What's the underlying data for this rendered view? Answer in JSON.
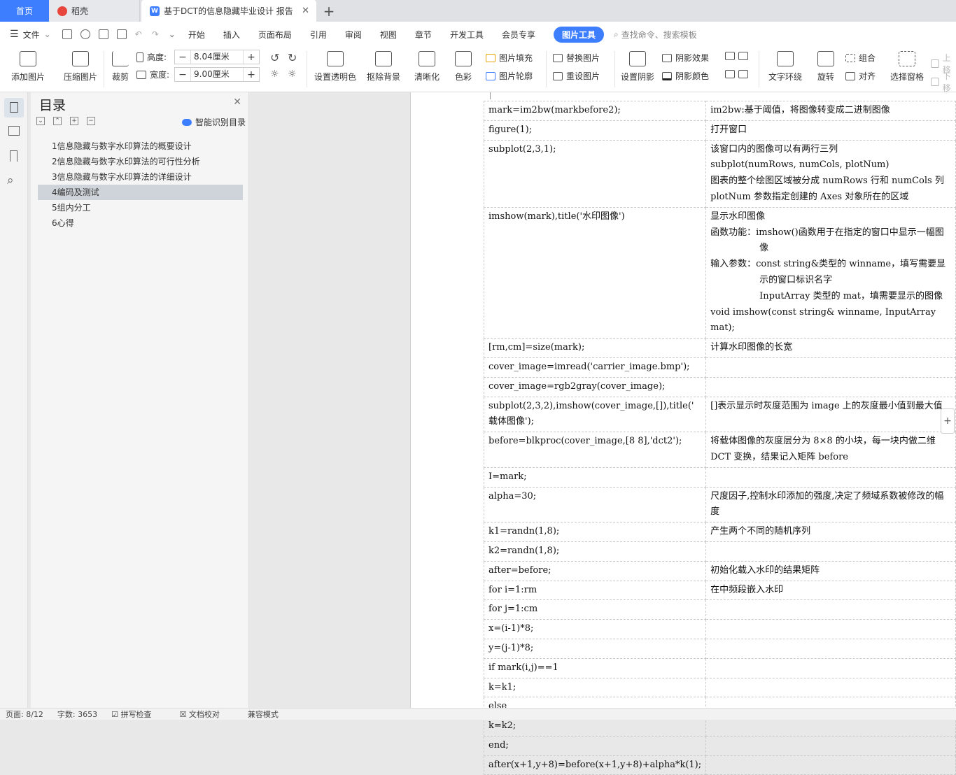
{
  "tabs": {
    "home": "首页",
    "daoke": "稻壳",
    "document": "基于DCT的信息隐藏毕业设计 报告"
  },
  "menubar": {
    "file": "文件",
    "items": [
      "开始",
      "插入",
      "页面布局",
      "引用",
      "审阅",
      "视图",
      "章节",
      "开发工具",
      "会员专享"
    ],
    "active": "图片工具",
    "search": "查找命令、搜索模板"
  },
  "ribbon": {
    "add_picture": "添加图片",
    "compress": "压缩图片",
    "crop": "裁剪",
    "height_label": "高度:",
    "height_value": "8.04厘米",
    "width_label": "宽度:",
    "width_value": "9.00厘米",
    "transparent": "设置透明色",
    "remove_bg": "抠除背景",
    "sharpen": "清晰化",
    "color": "色彩",
    "fill": "图片填充",
    "outline": "图片轮廓",
    "replace": "替换图片",
    "reset": "重设图片",
    "shadow": "设置阴影",
    "shadow_effect": "阴影效果",
    "shadow_color": "阴影颜色",
    "wrap": "文字环绕",
    "rotate": "旋转",
    "group": "组合",
    "align": "对齐",
    "select_pane": "选择窗格",
    "up": "上移",
    "down": "下移"
  },
  "toc": {
    "title": "目录",
    "smart": "智能识别目录",
    "items": [
      "1信息隐藏与数字水印算法的概要设计",
      "2信息隐藏与数字水印算法的可行性分析",
      "3信息隐藏与数字水印算法的详细设计",
      "4编码及测试",
      "5组内分工",
      "6心得"
    ]
  },
  "table": [
    [
      "mark=im2bw(markbefore2);",
      "im2bw:基于阈值，将图像转变成二进制图像"
    ],
    [
      "figure(1);",
      "打开窗口"
    ],
    [
      "subplot(2,3,1);",
      "该窗口内的图像可以有两行三列"
    ],
    [
      "imshow(mark),title('水印图像')",
      "显示水印图像"
    ],
    [
      "[rm,cm]=size(mark);",
      "计算水印图像的长宽"
    ],
    [
      "cover_image=imread('carrier_image.bmp');",
      ""
    ],
    [
      "cover_image=rgb2gray(cover_image);",
      ""
    ],
    [
      "subplot(2,3,2),imshow(cover_image,[]),title(' 载体图像');",
      "[]表示显示时灰度范围为 image 上的灰度最小值到最大值"
    ],
    [
      "before=blkproc(cover_image,[8 8],'dct2');",
      "将载体图像的灰度层分为 8×8 的小块，每一块内做二维 DCT 变换，结果记入矩阵 before"
    ],
    [
      "I=mark;",
      ""
    ],
    [
      "alpha=30;",
      "尺度因子,控制水印添加的强度,决定了频域系数被修改的幅度"
    ],
    [
      "k1=randn(1,8);",
      "产生两个不同的随机序列"
    ],
    [
      "k2=randn(1,8);",
      ""
    ],
    [
      "after=before;",
      "初始化载入水印的结果矩阵"
    ],
    [
      "for i=1:rm",
      "在中频段嵌入水印"
    ],
    [
      "for j=1:cm",
      ""
    ],
    [
      "x=(i-1)*8;",
      ""
    ],
    [
      "y=(j-1)*8;",
      ""
    ],
    [
      "if mark(i,j)==1",
      ""
    ],
    [
      "k=k1;",
      ""
    ],
    [
      "else",
      ""
    ],
    [
      "k=k2;",
      ""
    ],
    [
      "end;",
      ""
    ],
    [
      "after(x+1,y+8)=before(x+1,y+8)+alpha*k(1);",
      ""
    ]
  ],
  "extra": {
    "subplot_1": "subplot(numRows, numCols, plotNum)",
    "subplot_2": "图表的整个绘图区域被分成 numRows 行和 numCols 列",
    "subplot_3": "plotNum 参数指定创建的 Axes 对象所在的区域",
    "imshow_1": "函数功能：imshow()函数用于在指定的窗口中显示一幅图像",
    "imshow_2": "输入参数：const string&类型的 winname，填写需要显示的窗口标识名字",
    "imshow_3": "InputArray 类型的 mat，填需要显示的图像",
    "imshow_4": "void imshow(const string& winname, InputArray mat);"
  },
  "status": {
    "page": "页面: 8/12",
    "words": "字数: 3653",
    "spell": "拼写检查",
    "proof": "文档校对",
    "compat": "兼容模式"
  }
}
